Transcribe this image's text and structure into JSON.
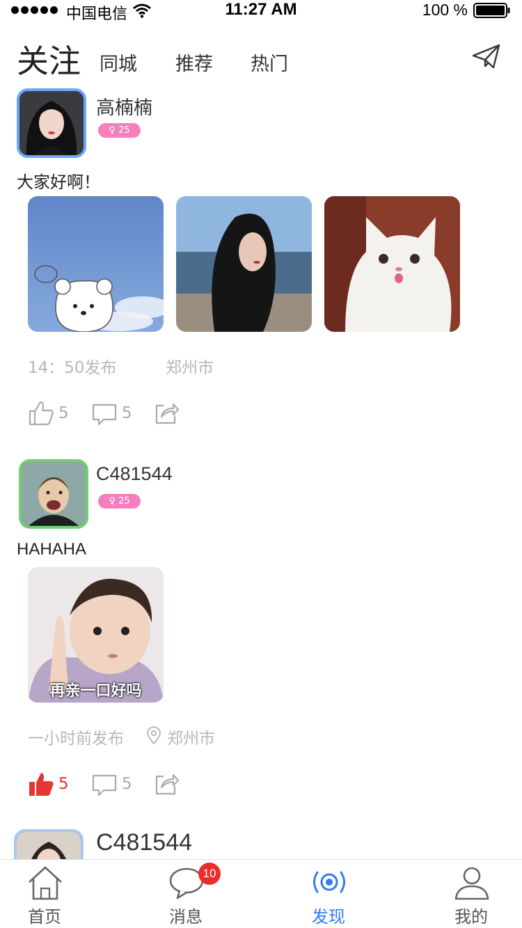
{
  "status_bar": {
    "carrier": "中国电信",
    "time": "11:27 AM",
    "battery_percent": "100 %",
    "signal_bars": 5
  },
  "header": {
    "active_tab": "关注",
    "tabs": [
      "同城",
      "推荐",
      "热门"
    ],
    "send_icon": "paper-plane-icon"
  },
  "posts": [
    {
      "username": "高楠楠",
      "badge": "25",
      "text": "大家好啊！",
      "time": "14：50发布",
      "location": "郑州市",
      "likes": "5",
      "comments": "5",
      "liked": false
    },
    {
      "username": "C481544",
      "badge": "25",
      "text": "HAHAHA",
      "image_caption": "再亲一口好吗",
      "time": "一小时前发布",
      "location": "郑州市",
      "likes": "5",
      "comments": "5",
      "liked": true
    },
    {
      "username": "C481544"
    }
  ],
  "tabbar": {
    "items": [
      {
        "label": "首页",
        "icon": "home-icon"
      },
      {
        "label": "消息",
        "icon": "chat-bubble-icon",
        "badge": "10"
      },
      {
        "label": "发现",
        "icon": "broadcast-icon",
        "active": true
      },
      {
        "label": "我的",
        "icon": "person-icon"
      }
    ]
  },
  "colors": {
    "accent": "#2f7cf2",
    "badge_pink": "#f57fbd",
    "like_red": "#e53535",
    "notification_red": "#ee2c2c"
  }
}
